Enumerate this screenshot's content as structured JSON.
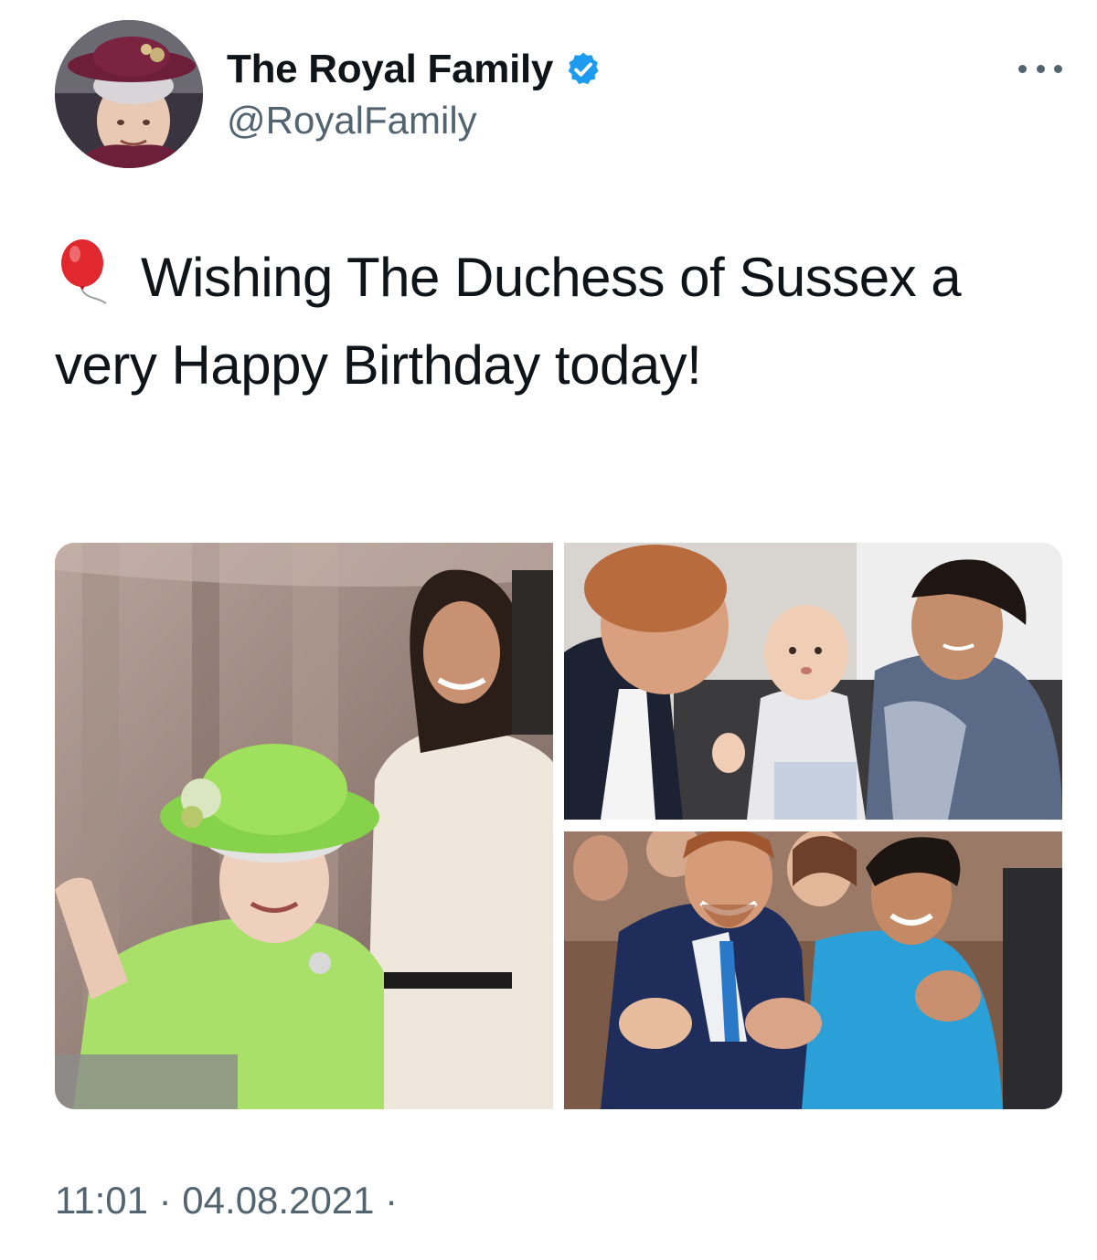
{
  "account": {
    "display_name": "The Royal Family",
    "handle": "@RoyalFamily",
    "verified": true,
    "avatar_icon": "profile-photo",
    "verified_color": "#1d9bf0"
  },
  "tweet": {
    "emoji_icon": "red-balloon-icon",
    "text": "Wishing The Duchess of Sussex a very Happy Birthday today!",
    "timestamp": "11:01 · 04.08.2021 ·"
  },
  "media": {
    "photo_count": 3,
    "photos": [
      {
        "icon": "photo-queen-and-duchess"
      },
      {
        "icon": "photo-family-with-baby"
      },
      {
        "icon": "photo-couple-applauding"
      }
    ]
  },
  "menu": {
    "more_icon": "more-options-icon"
  },
  "colors": {
    "text_primary": "#0f1419",
    "text_secondary": "#536471"
  }
}
